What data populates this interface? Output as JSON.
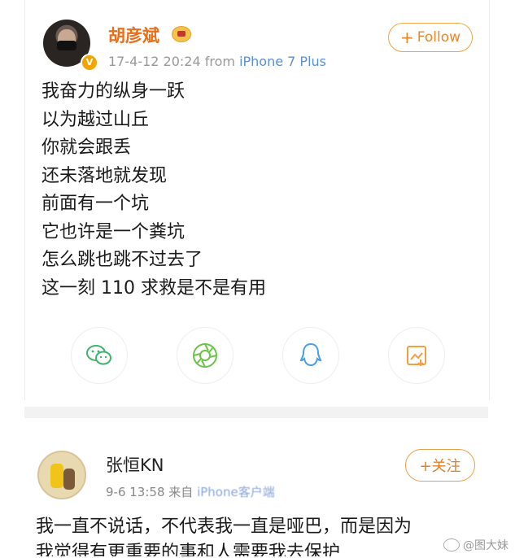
{
  "post": {
    "author": "胡彦斌",
    "verified_badge": "V",
    "timestamp": "17-4-12 20:24",
    "source_prefix": "from",
    "source": "iPhone 7 Plus",
    "follow_plus": "+",
    "follow_label": "Follow",
    "lines": [
      "我奋力的纵身一跃",
      "以为越过山丘",
      "你就会跟丢",
      "还未落地就发现",
      "前面有一个坑",
      "它也许是一个粪坑",
      "怎么跳也跳不过去了",
      "这一刻 110 求救是不是有用"
    ],
    "share_icons": [
      "wechat-icon",
      "moments-icon",
      "qq-icon",
      "save-image-icon"
    ],
    "colors": {
      "name": "#e86f1a",
      "accent": "#e8862a",
      "link": "#5b8fd6"
    }
  },
  "comment": {
    "author": "张恒KN",
    "timestamp": "9-6 13:58",
    "source_prefix": "来自",
    "source": "iPhone客户端",
    "follow_label": "+关注",
    "lines": [
      "我一直不说话，不代表我一直是哑巴，而是因为",
      "我觉得有更重要的事和人需要我去保护"
    ]
  },
  "watermark": {
    "text": "@图大妹"
  }
}
